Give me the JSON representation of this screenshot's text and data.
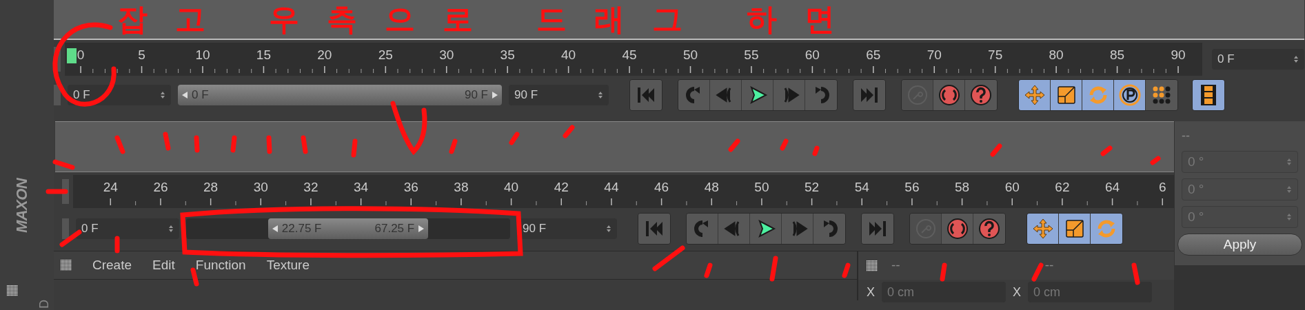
{
  "side_strip": {
    "logo": "MAXON",
    "tab_label": "D"
  },
  "annotation": {
    "text": "잡고 우측으로 드래그 하면"
  },
  "panels": [
    {
      "ruler": {
        "labels": [
          "0",
          "5",
          "10",
          "15",
          "20",
          "25",
          "30",
          "35",
          "40",
          "45",
          "50",
          "55",
          "60",
          "65",
          "70",
          "75",
          "80",
          "85",
          "90"
        ],
        "playhead": true
      },
      "current_frame": "0 F",
      "start_field": "0 F",
      "range": {
        "left": "0 F",
        "right": "90 F"
      },
      "end_field": "90 F",
      "key_button": {
        "disabled": true
      },
      "modes": [
        {
          "selected": true
        },
        {
          "selected": true
        },
        {
          "selected": true
        },
        {
          "selected": true
        },
        {
          "selected": false
        },
        {
          "selected": true
        }
      ]
    },
    {
      "ruler": {
        "labels": [
          "24",
          "26",
          "28",
          "30",
          "32",
          "34",
          "36",
          "38",
          "40",
          "42",
          "44",
          "46",
          "48",
          "50",
          "52",
          "54",
          "56",
          "58",
          "60",
          "62",
          "64",
          "6"
        ],
        "playhead": false
      },
      "start_field": "0 F",
      "range": {
        "left": "22.75 F",
        "right": "67.25 F"
      },
      "end_field": "90 F",
      "key_button": {
        "disabled": true
      },
      "modes": [
        {
          "selected": true
        },
        {
          "selected": true
        },
        {
          "selected": true
        }
      ]
    }
  ],
  "menu": [
    "Create",
    "Edit",
    "Function",
    "Texture"
  ],
  "sub_panel": {
    "titles": [
      "--",
      "--"
    ],
    "coords": [
      {
        "axis": "X",
        "value": "0 cm"
      },
      {
        "axis": "X",
        "value": "0 cm"
      }
    ]
  },
  "attributes": {
    "title": "--",
    "angles": [
      "0 °",
      "0 °",
      "0 °"
    ],
    "apply": "Apply"
  }
}
